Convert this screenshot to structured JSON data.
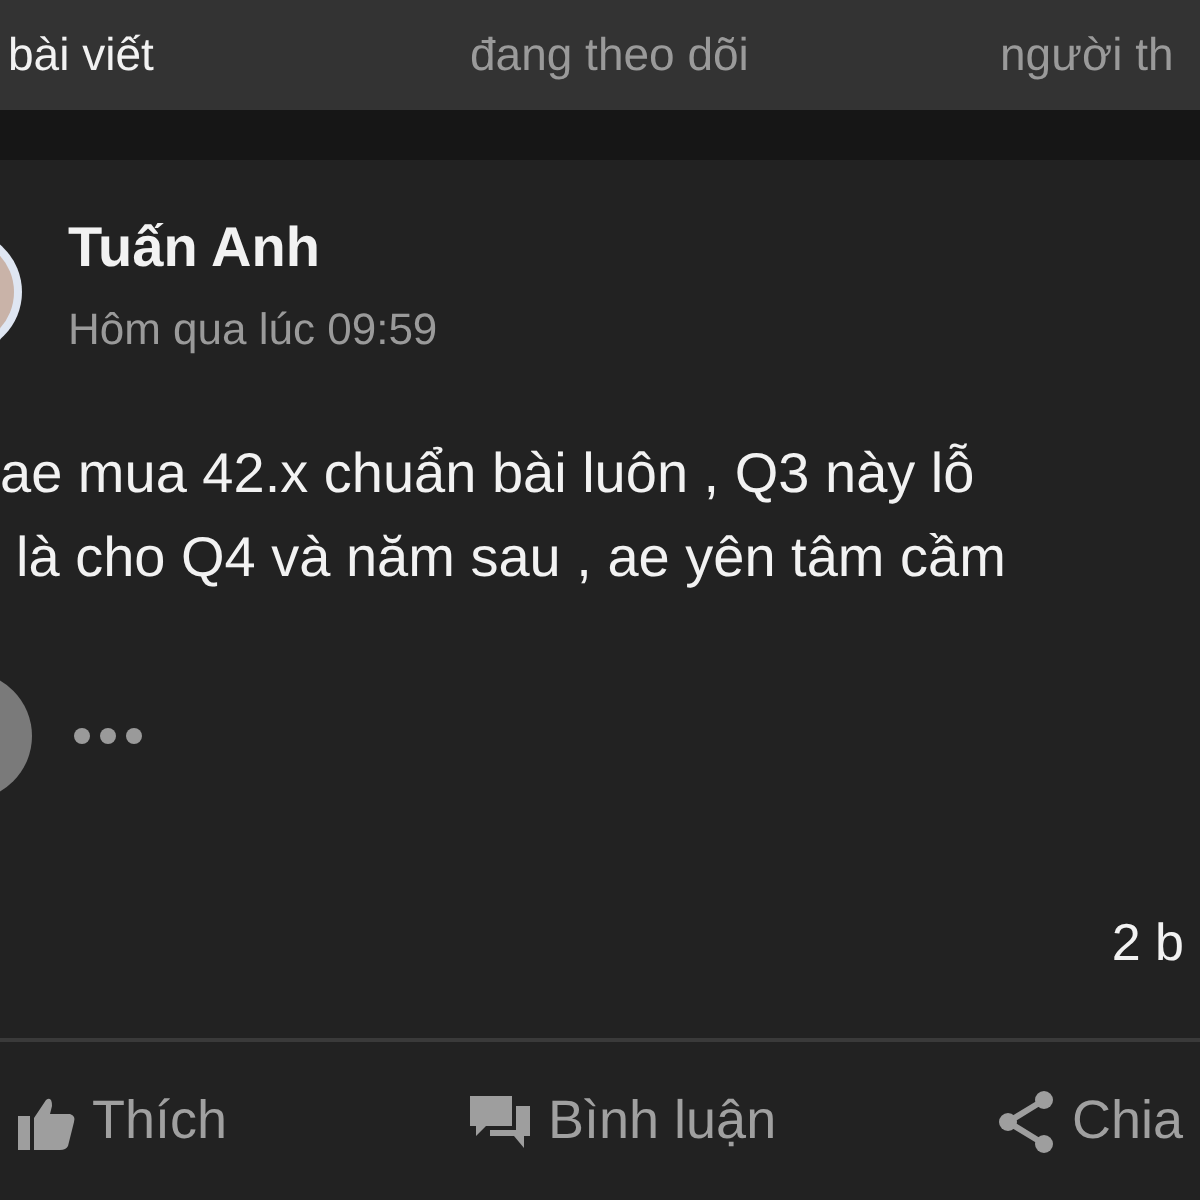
{
  "tabs": [
    {
      "label": "bài viết",
      "selected": true
    },
    {
      "label": "đang theo dõi",
      "selected": false
    },
    {
      "label": "người th",
      "selected": false
    }
  ],
  "post": {
    "author": "Tuấn Anh",
    "time": "Hôm qua lúc 09:59",
    "lines": [
      "ae mua 42.x chuẩn bài luôn , Q3 này lỗ",
      "là cho Q4 và năm sau , ae yên tâm cầm"
    ],
    "comment_count": "2 b"
  },
  "actions": [
    {
      "kind": "like",
      "label": "Thích"
    },
    {
      "kind": "comment",
      "label": "Bình luận"
    },
    {
      "kind": "share",
      "label": "Chia"
    }
  ]
}
